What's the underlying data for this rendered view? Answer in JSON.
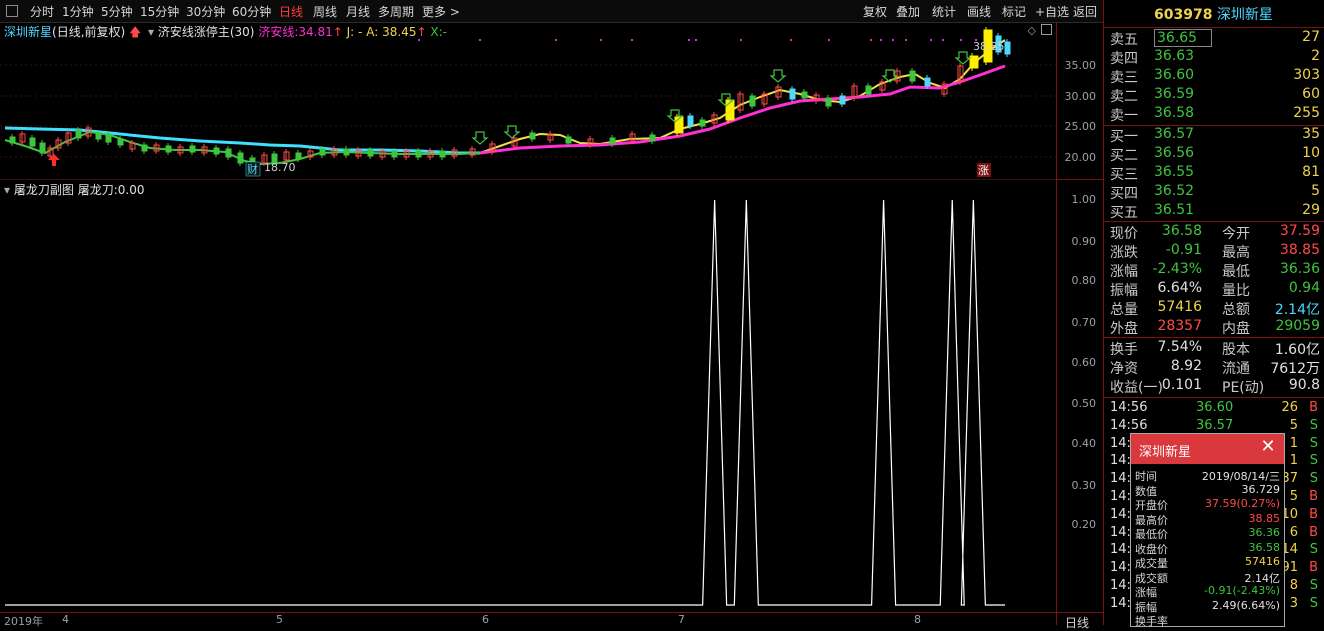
{
  "toolbar": {
    "items": [
      "分时",
      "1分钟",
      "5分钟",
      "15分钟",
      "30分钟",
      "60分钟",
      "日线",
      "周线",
      "月线",
      "多周期",
      "更多 >"
    ],
    "active": "日线",
    "right_items": [
      "复权",
      "叠加",
      "统计",
      "画线",
      "标记",
      "+自选",
      "返回"
    ]
  },
  "main_header": {
    "stock": "深圳新星",
    "mode": "(日线,前复权)",
    "indicator": "济安线涨停主(30)",
    "jianline_label": "济安线:",
    "jianline_value": "34.81",
    "j_label": "J:",
    "j_value": "-",
    "a_label": "A:",
    "a_value": "38.45",
    "x_label": "X:",
    "x_value": "-"
  },
  "sub_header": {
    "title": "屠龙刀副图",
    "label": "屠龙刀:",
    "value": "0.00"
  },
  "main_axis": [
    "35.00",
    "30.00",
    "25.00",
    "20.00"
  ],
  "sub_axis": [
    "1.00",
    "0.90",
    "0.80",
    "0.70",
    "0.60",
    "0.50",
    "0.40",
    "0.30",
    "0.20"
  ],
  "x_axis": [
    "2019年",
    "4",
    "5",
    "6",
    "7",
    "8"
  ],
  "x_axis_right": "日线",
  "annotations": {
    "low": "18.70",
    "high": "38.85",
    "cai": "财",
    "zhang": "涨"
  },
  "colors": {
    "up": "#ff4a4a",
    "down": "#3fc43f",
    "jianline": "#ff2fd0",
    "cyan_line": "#3fe0ff",
    "yellow_line": "#f0e04a",
    "grid": "#7a1111"
  },
  "quote": {
    "code": "603978",
    "name": "深圳新星",
    "asks": [
      {
        "label": "卖五",
        "price": "36.65",
        "vol": "27"
      },
      {
        "label": "卖四",
        "price": "36.63",
        "vol": "2"
      },
      {
        "label": "卖三",
        "price": "36.60",
        "vol": "303"
      },
      {
        "label": "卖二",
        "price": "36.59",
        "vol": "60"
      },
      {
        "label": "卖一",
        "price": "36.58",
        "vol": "255"
      }
    ],
    "bids": [
      {
        "label": "买一",
        "price": "36.57",
        "vol": "35"
      },
      {
        "label": "买二",
        "price": "36.56",
        "vol": "10"
      },
      {
        "label": "买三",
        "price": "36.55",
        "vol": "81"
      },
      {
        "label": "买四",
        "price": "36.52",
        "vol": "5"
      },
      {
        "label": "买五",
        "price": "36.51",
        "vol": "29"
      }
    ],
    "stats": [
      [
        "现价",
        "36.58",
        "今开",
        "37.59"
      ],
      [
        "涨跌",
        "-0.91",
        "最高",
        "38.85"
      ],
      [
        "涨幅",
        "-2.43%",
        "最低",
        "36.36"
      ],
      [
        "振幅",
        "6.64%",
        "量比",
        "0.94"
      ],
      [
        "总量",
        "57416",
        "总额",
        "2.14亿"
      ],
      [
        "外盘",
        "28357",
        "内盘",
        "29059"
      ]
    ],
    "stats2": [
      [
        "换手",
        "7.54%",
        "股本",
        "1.60亿"
      ],
      [
        "净资",
        "8.92",
        "流通",
        "7612万"
      ],
      [
        "收益(一)",
        "0.101",
        "PE(动)",
        "90.8"
      ]
    ],
    "ticks": [
      {
        "time": "14:56",
        "price": "36.60",
        "vol": "26",
        "side": "B"
      },
      {
        "time": "14:56",
        "price": "36.57",
        "vol": "5",
        "side": "S"
      },
      {
        "time": "14:",
        "price": "",
        "vol": "1",
        "side": "S"
      },
      {
        "time": "14:",
        "price": "",
        "vol": "1",
        "side": "S"
      },
      {
        "time": "14:",
        "price": "",
        "vol": "37",
        "side": "S"
      },
      {
        "time": "14:",
        "price": "",
        "vol": "5",
        "side": "B"
      },
      {
        "time": "14:",
        "price": "",
        "vol": "10",
        "side": "B"
      },
      {
        "time": "14:",
        "price": "",
        "vol": "6",
        "side": "B"
      },
      {
        "time": "14:",
        "price": "",
        "vol": "14",
        "side": "S"
      },
      {
        "time": "14:",
        "price": "",
        "vol": "91",
        "side": "B"
      },
      {
        "time": "14:",
        "price": "",
        "vol": "8",
        "side": "S"
      },
      {
        "time": "14:",
        "price": "",
        "vol": "3",
        "side": "S"
      }
    ]
  },
  "popup": {
    "title": "深圳新星",
    "rows": [
      [
        "时间",
        "2019/08/14/三"
      ],
      [
        "数值",
        "36.729"
      ],
      [
        "开盘价",
        "37.59(0.27%)"
      ],
      [
        "最高价",
        "38.85"
      ],
      [
        "最低价",
        "36.36"
      ],
      [
        "收盘价",
        "36.58"
      ],
      [
        "成交量",
        "57416"
      ],
      [
        "成交额",
        "2.14亿"
      ],
      [
        "涨幅",
        "-0.91(-2.43%)"
      ],
      [
        "振幅",
        "2.49(6.64%)"
      ],
      [
        "换手率",
        ""
      ]
    ]
  },
  "chart_data": {
    "type": "line",
    "sub_indicator": "屠龙刀",
    "ylim": [
      0,
      1
    ],
    "spikes_x_fraction": [
      0.69,
      0.72,
      0.85,
      0.915,
      0.935
    ],
    "baseline": 0,
    "peak": 1.0
  }
}
